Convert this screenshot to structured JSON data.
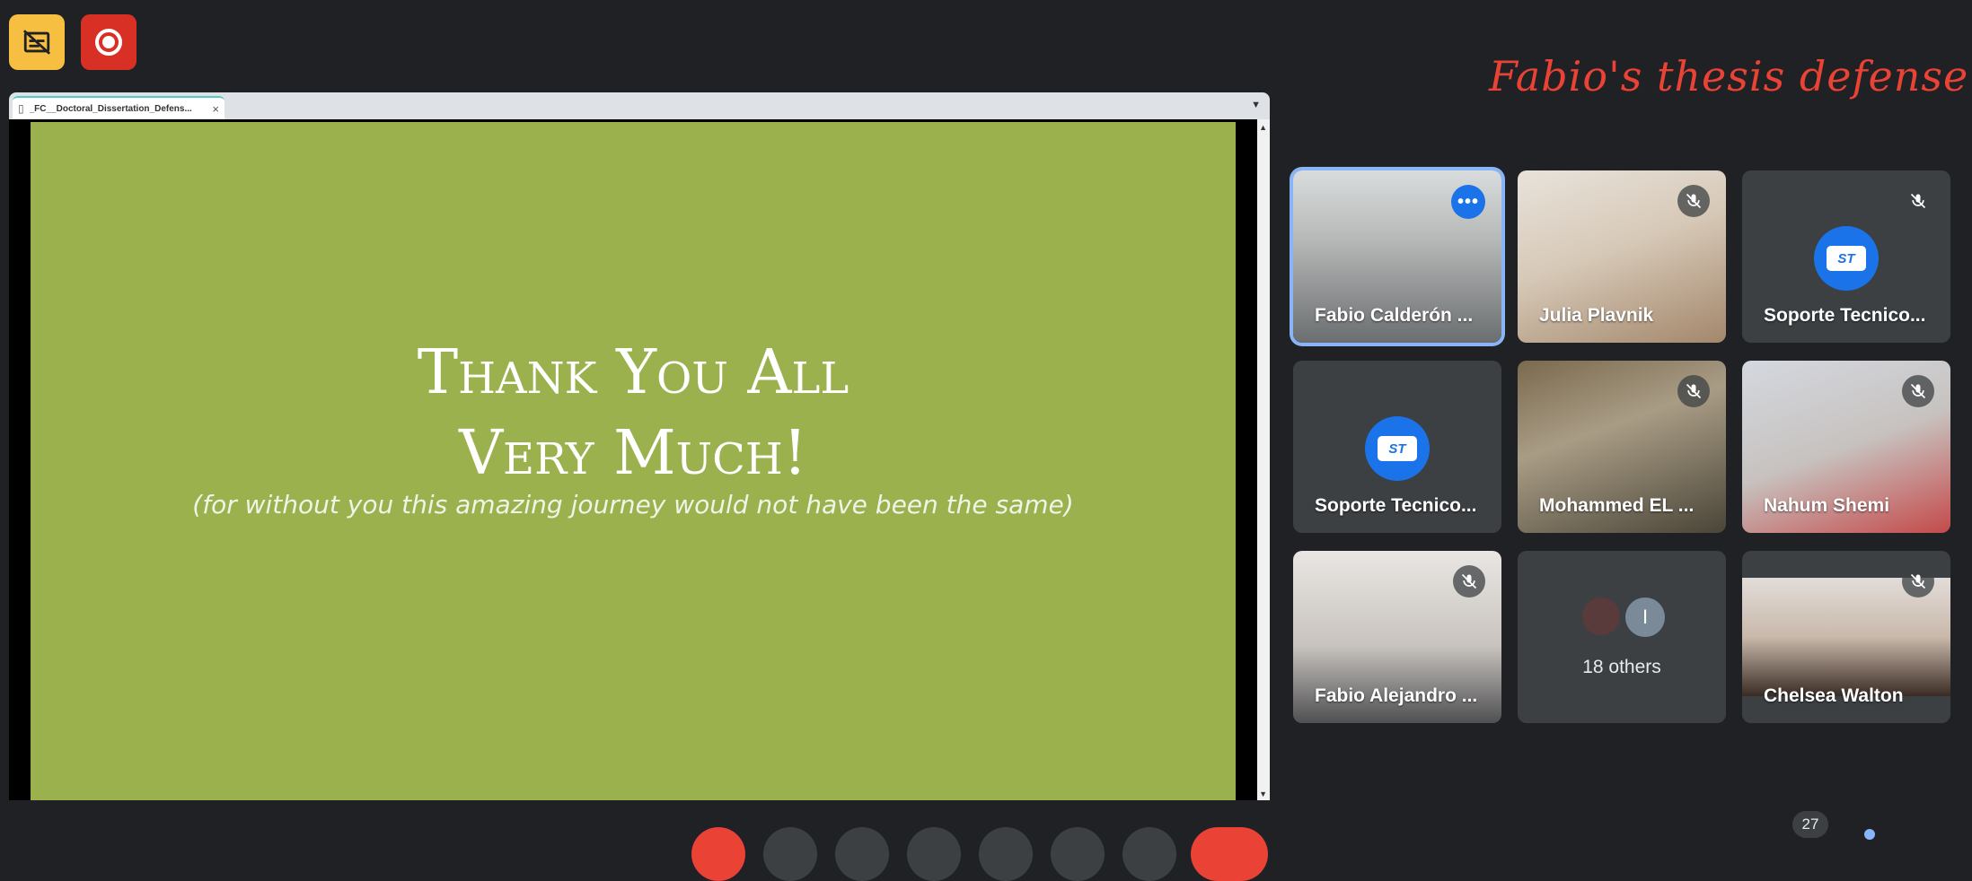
{
  "meeting": {
    "title": "Fabio's thesis defense"
  },
  "presentation": {
    "tab_title": "_FC__Doctoral_Dissertation_Defens...",
    "tab_close": "×",
    "slide": {
      "line1": "Thank You All",
      "line2": "Very Much!",
      "subtitle": "(for without you this amazing journey would not have been the same)"
    }
  },
  "participants": [
    {
      "name": "Fabio Calderón ...",
      "active": true
    },
    {
      "name": "Julia Plavnik",
      "muted": true
    },
    {
      "name": "Soporte Tecnico...",
      "muted": true,
      "logo": "ST"
    },
    {
      "name": "Soporte Tecnico...",
      "logo": "ST"
    },
    {
      "name": "Mohammed EL ...",
      "muted": true
    },
    {
      "name": "Nahum Shemi",
      "muted": true
    },
    {
      "name": "Fabio Alejandro ...",
      "muted": true
    },
    {
      "name": "Chelsea Walton",
      "muted": true
    }
  ],
  "others": {
    "label": "18 others",
    "avatar_letter": "I"
  },
  "toolbar": {
    "participant_count": "27"
  },
  "colors": {
    "accent": "#1a73e8",
    "danger": "#ea4335",
    "slide_bg": "#9ab14e",
    "warning": "#f6bf41"
  },
  "icons": [
    "captions-off-icon",
    "record-icon",
    "mic-off-icon",
    "more-icon"
  ]
}
